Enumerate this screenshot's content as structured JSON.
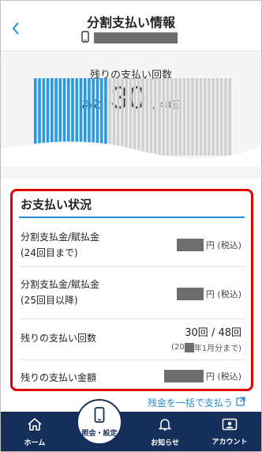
{
  "header": {
    "title": "分割支払い情報",
    "back_icon": "chevron-left-icon",
    "device_icon": "smartphone-icon"
  },
  "remaining": {
    "label": "残りの支払い回数",
    "prefix": "あと",
    "count": "30",
    "total": "/ 48回",
    "paid_fraction": 0.375
  },
  "status": {
    "title": "お支払い状況",
    "rows": [
      {
        "label_line1": "分割支払金/賦払金",
        "label_line2": "(24回目まで)",
        "unit": "円 (税込)"
      },
      {
        "label_line1": "分割支払金/賦払金",
        "label_line2": "(25回目以降)",
        "unit": "円 (税込)"
      },
      {
        "label_line1": "残りの支払い回数",
        "value": "30回 / 48回",
        "sub_prefix": "(20",
        "sub_suffix": "年1月分まで)"
      },
      {
        "label_line1": "残りの支払い金額",
        "unit": "円 (税込)"
      }
    ]
  },
  "lump_sum_link": "残金を一括で支払う",
  "nav": {
    "home": "ホーム",
    "inquiry": "照会・設定",
    "notice": "お知らせ",
    "account": "アカウント"
  },
  "colors": {
    "accent": "#2a8ad6",
    "paid_bar": "#2a9be0",
    "unpaid_bar": "#d0d0d0",
    "highlight_border": "#e00000",
    "nav_bg": "#14305a"
  }
}
